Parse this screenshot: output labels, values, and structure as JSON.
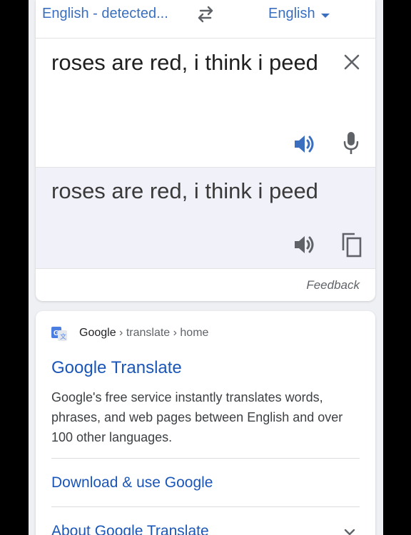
{
  "translate": {
    "source_lang": "English - detected...",
    "target_lang": "English",
    "source_text": "roses are red, i think i peed",
    "result_text": "roses are red, i think i peed",
    "feedback": "Feedback",
    "accent_color": "#3a6fc0"
  },
  "icons": {
    "swap": "swap-arrows-icon",
    "caret": "caret-down-icon",
    "clear": "close-icon",
    "listen_source": "speaker-icon",
    "mic": "microphone-icon",
    "listen_result": "speaker-icon",
    "copy": "copy-icon",
    "favicon": "google-translate-favicon",
    "expand": "chevron-down-icon"
  },
  "search_result": {
    "site": "Google",
    "path": " › translate › home",
    "title": "Google Translate",
    "snippet": "Google's free service instantly translates words, phrases, and web pages between English and over 100 other languages.",
    "sitelinks": [
      "Download & use Google",
      "About Google Translate"
    ],
    "link_color": "#1a56b8"
  }
}
